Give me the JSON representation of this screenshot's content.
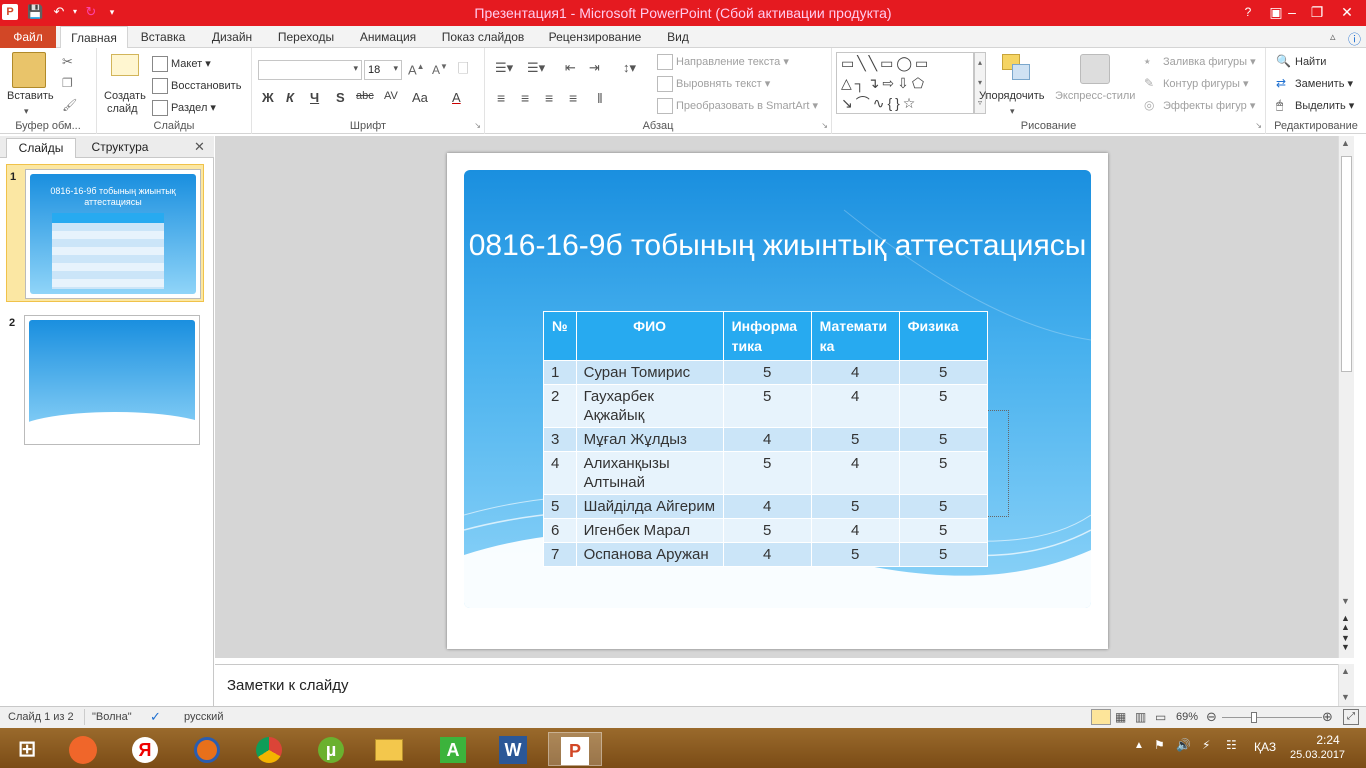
{
  "window": {
    "title": "Презентация1 - Microsoft PowerPoint (Сбой активации продукта)",
    "qa_icons": [
      "powerpoint-logo",
      "save-icon",
      "undo-icon",
      "redo-icon",
      "customize-icon"
    ]
  },
  "tabs": {
    "file": "Файл",
    "items": [
      "Главная",
      "Вставка",
      "Дизайн",
      "Переходы",
      "Анимация",
      "Показ слайдов",
      "Рецензирование",
      "Вид"
    ]
  },
  "ribbon": {
    "clipboard": {
      "paste": "Вставить",
      "label": "Буфер обм..."
    },
    "slides": {
      "new_slide_1": "Создать",
      "new_slide_2": "слайд",
      "layout": "Макет",
      "reset": "Восстановить",
      "section": "Раздел",
      "label": "Слайды"
    },
    "font": {
      "size": "18",
      "label": "Шрифт",
      "bold": "Ж",
      "italic": "К",
      "underline": "Ч",
      "shadow": "S",
      "strike": "abc",
      "spacing": "AV",
      "case": "Aa",
      "color": "A"
    },
    "paragraph": {
      "text_direction": "Направление текста",
      "align_text": "Выровнять текст",
      "smartart": "Преобразовать в SmartArt",
      "label": "Абзац"
    },
    "drawing": {
      "arrange": "Упорядочить",
      "quick_styles": "Экспресс-стили",
      "fill": "Заливка фигуры",
      "outline": "Контур фигуры",
      "effects": "Эффекты фигур",
      "label": "Рисование"
    },
    "editing": {
      "find": "Найти",
      "replace": "Заменить",
      "select": "Выделить",
      "label": "Редактирование"
    }
  },
  "pane": {
    "tab_slides": "Слайды",
    "tab_outline": "Структура",
    "slide1_num": "1",
    "slide2_num": "2"
  },
  "slide": {
    "title": "0816-16-9б тобының жиынтық аттестациясы",
    "headers": [
      "№",
      "ФИО",
      "Информа тика",
      "Математи ка",
      "Физика"
    ],
    "rows": [
      [
        "1",
        "Суран Томирис",
        "5",
        "4",
        "5"
      ],
      [
        "2",
        "Гаухарбек Ақжайық",
        "5",
        "4",
        "5"
      ],
      [
        "3",
        "Мұғал Жұлдыз",
        "4",
        "5",
        "5"
      ],
      [
        "4",
        "Алиханқызы Алтынай",
        "5",
        "4",
        "5"
      ],
      [
        "5",
        "Шайділда Айгерим",
        "4",
        "5",
        "5"
      ],
      [
        "6",
        "Игенбек Марал",
        "5",
        "4",
        "5"
      ],
      [
        "7",
        "Оспанова Аружан",
        "4",
        "5",
        "5"
      ]
    ]
  },
  "notes": {
    "placeholder": "Заметки к слайду"
  },
  "status": {
    "slide_of": "Слайд 1 из 2",
    "theme": "\"Волна\"",
    "language": "русский",
    "zoom": "69%"
  },
  "taskbar": {
    "apps": [
      "start",
      "media-player",
      "yandex-browser",
      "firefox",
      "chrome",
      "utorrent",
      "file-explorer",
      "avast",
      "word",
      "powerpoint"
    ],
    "lang": "ҚАЗ",
    "time": "2:24",
    "date": "25.03.2017"
  }
}
